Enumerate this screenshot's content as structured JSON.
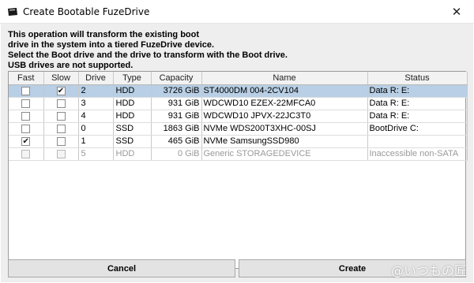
{
  "window": {
    "title": "Create Bootable FuzeDrive",
    "close_glyph": "✕"
  },
  "description": {
    "lines": [
      "This operation will transform the existing boot",
      "drive in the system into a tiered FuzeDrive device.",
      "Select the Boot drive and the drive to transform with the Boot drive.",
      "USB drives are not supported."
    ]
  },
  "table": {
    "columns": [
      "Fast",
      "Slow",
      "Drive",
      "Type",
      "Capacity",
      "Name",
      "Status"
    ],
    "rows": [
      {
        "fast": false,
        "slow": true,
        "drive": "2",
        "type": "HDD",
        "capacity": "3726 GiB",
        "name": "ST4000DM 004-2CV104",
        "status": "Data R: E:",
        "selected": true,
        "disabled": false
      },
      {
        "fast": false,
        "slow": false,
        "drive": "3",
        "type": "HDD",
        "capacity": "931 GiB",
        "name": "WDCWD10 EZEX-22MFCA0",
        "status": "Data R: E:",
        "selected": false,
        "disabled": false
      },
      {
        "fast": false,
        "slow": false,
        "drive": "4",
        "type": "HDD",
        "capacity": "931 GiB",
        "name": "WDCWD10 JPVX-22JC3T0",
        "status": "Data R: E:",
        "selected": false,
        "disabled": false
      },
      {
        "fast": false,
        "slow": false,
        "drive": "0",
        "type": "SSD",
        "capacity": "1863 GiB",
        "name": "NVMe WDS200T3XHC-00SJ",
        "status": "BootDrive C:",
        "selected": false,
        "disabled": false
      },
      {
        "fast": true,
        "slow": false,
        "drive": "1",
        "type": "SSD",
        "capacity": "465 GiB",
        "name": "NVMe SamsungSSD980",
        "status": "",
        "selected": false,
        "disabled": false
      },
      {
        "fast": false,
        "slow": false,
        "drive": "5",
        "type": "HDD",
        "capacity": "0 GiB",
        "name": "Generic STORAGEDEVICE",
        "status": "Inaccessible  non-SATA",
        "selected": false,
        "disabled": true
      }
    ]
  },
  "buttons": {
    "cancel": "Cancel",
    "create": "Create"
  },
  "watermark": "@いつもの匠",
  "colors": {
    "selection": "#b8cfe5",
    "dialog_bg": "#eeeeee"
  }
}
